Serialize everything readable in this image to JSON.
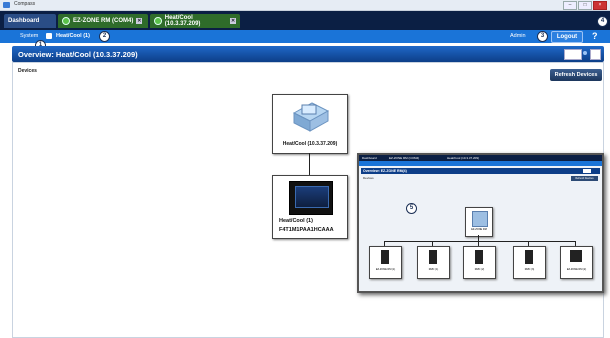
{
  "window": {
    "title": "Compass"
  },
  "tabs": [
    {
      "label": "Dashboard"
    },
    {
      "label": "EZ-ZONE RM (COM4)"
    },
    {
      "label": "Heat/Cool (10.3.37.209)"
    }
  ],
  "nav": {
    "system_label": "System",
    "device_label": "Heat/Cool (1)",
    "user_label": "Admin",
    "logout_label": "Logout",
    "help_label": "?"
  },
  "callouts": {
    "c1": "1",
    "c2": "2",
    "c3": "3",
    "c4": "4",
    "c5": "5"
  },
  "overview": {
    "title": "Overview: Heat/Cool (10.3.37.209)",
    "section_label": "Devices",
    "refresh_label": "Refresh Devices"
  },
  "devices": {
    "controller": {
      "label": "Heat/Cool (10.3.37.209)"
    },
    "panel": {
      "name": "Heat/Cool (1)",
      "model": "F4T1M1PAA1HCAAA"
    }
  },
  "inset": {
    "tabs": [
      "Dashboard",
      "EZ-ZONE RM (COM4)",
      "Heat/Cool (10.3.37.209)"
    ],
    "title": "Overview: EZ-ZONE RM(4)",
    "section_label": "Devices",
    "refresh_label": "Refresh Devices",
    "hub_label": "EZ-ZONE RM",
    "modules": [
      {
        "label": "EZ-ZONE RM (1)"
      },
      {
        "label": "RMC (1)"
      },
      {
        "label": "RMC (2)"
      },
      {
        "label": "RMC (3)"
      },
      {
        "label": "EZ-ZONE RM (2)"
      }
    ]
  },
  "colors": {
    "tabbar": "#0b1f44",
    "navbar": "#1a74d8",
    "header": "#1f68c8",
    "active_dot": "#5bc14a"
  }
}
